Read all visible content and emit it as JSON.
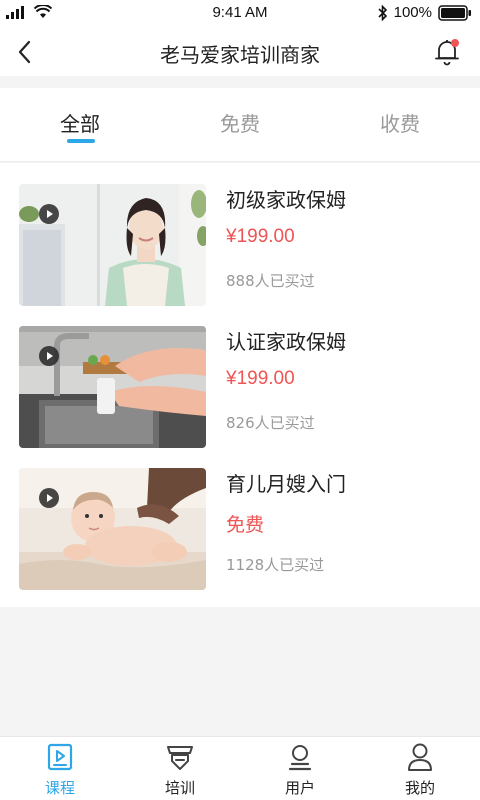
{
  "status_bar": {
    "time": "9:41 AM",
    "battery": "100%"
  },
  "header": {
    "title": "老马爱家培训商家"
  },
  "tabs": [
    {
      "label": "全部",
      "active": true
    },
    {
      "label": "免费",
      "active": false
    },
    {
      "label": "收费",
      "active": false
    }
  ],
  "courses": [
    {
      "title": "初级家政保姆",
      "price": "¥199.00",
      "sales": "888人已买过"
    },
    {
      "title": "认证家政保姆",
      "price": "¥199.00",
      "sales": "826人已买过"
    },
    {
      "title": "育儿月嫂入门",
      "price": "免费",
      "sales": "1128人已买过"
    }
  ],
  "bottom_nav": [
    {
      "label": "课程",
      "icon": "play-icon",
      "active": true
    },
    {
      "label": "培训",
      "icon": "training-icon",
      "active": false
    },
    {
      "label": "用户",
      "icon": "users-icon",
      "active": false
    },
    {
      "label": "我的",
      "icon": "person-icon",
      "active": false
    }
  ],
  "colors": {
    "accent": "#2ea7e8",
    "price": "#f05454",
    "notification_dot": "#f05454"
  }
}
